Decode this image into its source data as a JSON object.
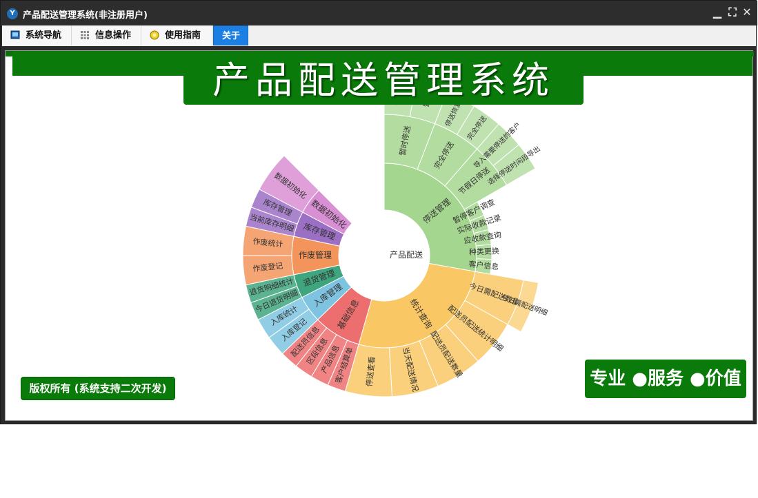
{
  "window": {
    "title": "产品配送管理系统(非注册用户)",
    "app_icon": "Y",
    "controls": {
      "minimize": "▁",
      "restore": "⛶",
      "close": "✕"
    }
  },
  "menu": [
    {
      "label": "系统导航",
      "icon": "monitor-icon",
      "active": false
    },
    {
      "label": "信息操作",
      "icon": "grid-icon",
      "active": false
    },
    {
      "label": "使用指南",
      "icon": "help-icon",
      "active": false
    },
    {
      "label": "关于",
      "icon": "",
      "active": true
    }
  ],
  "banner": {
    "title": "产品配送管理系统"
  },
  "footer": {
    "copyright": "版权所有 (系统支持二次开发)",
    "motto": "专业 ●服务 ●价值"
  },
  "colors": {
    "brand_green": "#0a7a0a",
    "active_tab": "#1c7fe3"
  },
  "chart_data": {
    "type": "sunburst",
    "root": "产品配送",
    "children": [
      {
        "name": "停送管理",
        "color": "#a5d68f",
        "children": [
          {
            "name": "客户信息"
          },
          {
            "name": "种类更换"
          },
          {
            "name": "应收款查询"
          },
          {
            "name": "实际收款记录"
          },
          {
            "name": "暂停客户调查"
          },
          {
            "name": "节假日停送",
            "children": [
              {
                "name": "导入需要停送的客户"
              },
              {
                "name": "选择停送时间段导出"
              }
            ]
          },
          {
            "name": "完全停送",
            "children": [
              {
                "name": "停送恢复"
              },
              {
                "name": "完全停送"
              }
            ]
          },
          {
            "name": "暂时停送",
            "children": [
              {
                "name": "暂停"
              },
              {
                "name": "暂"
              }
            ]
          }
        ]
      },
      {
        "name": "统计查询",
        "color": "#f9c865",
        "children": [
          {
            "name": "今日需配送数量",
            "children": [
              {
                "name": "今日需配送明细"
              }
            ]
          },
          {
            "name": "配送员配送统计明细"
          },
          {
            "name": "配送员配送数量"
          },
          {
            "name": "当天配送情况"
          },
          {
            "name": "停送查看"
          }
        ]
      },
      {
        "name": "基础信息",
        "color": "#ed6e6e",
        "children": [
          {
            "name": "客户结算单"
          },
          {
            "name": "产品信息"
          },
          {
            "name": "区段信息"
          },
          {
            "name": "配送员信息"
          }
        ]
      },
      {
        "name": "入库管理",
        "color": "#7ec4e0",
        "children": [
          {
            "name": "入库登记"
          },
          {
            "name": "入库统计"
          }
        ]
      },
      {
        "name": "退货管理",
        "color": "#3fa57e",
        "children": [
          {
            "name": "今日退货明细"
          },
          {
            "name": "退货明细统计"
          }
        ]
      },
      {
        "name": "作废管理",
        "color": "#f3945a",
        "children": [
          {
            "name": "作废登记"
          },
          {
            "name": "作废统计"
          }
        ]
      },
      {
        "name": "库存管理",
        "color": "#9b6fc4",
        "children": [
          {
            "name": "当前库存明细"
          },
          {
            "name": "库存管理"
          }
        ]
      },
      {
        "name": "数据初始化",
        "color": "#d98fd4",
        "children": [
          {
            "name": "数据初始化"
          }
        ]
      }
    ]
  }
}
